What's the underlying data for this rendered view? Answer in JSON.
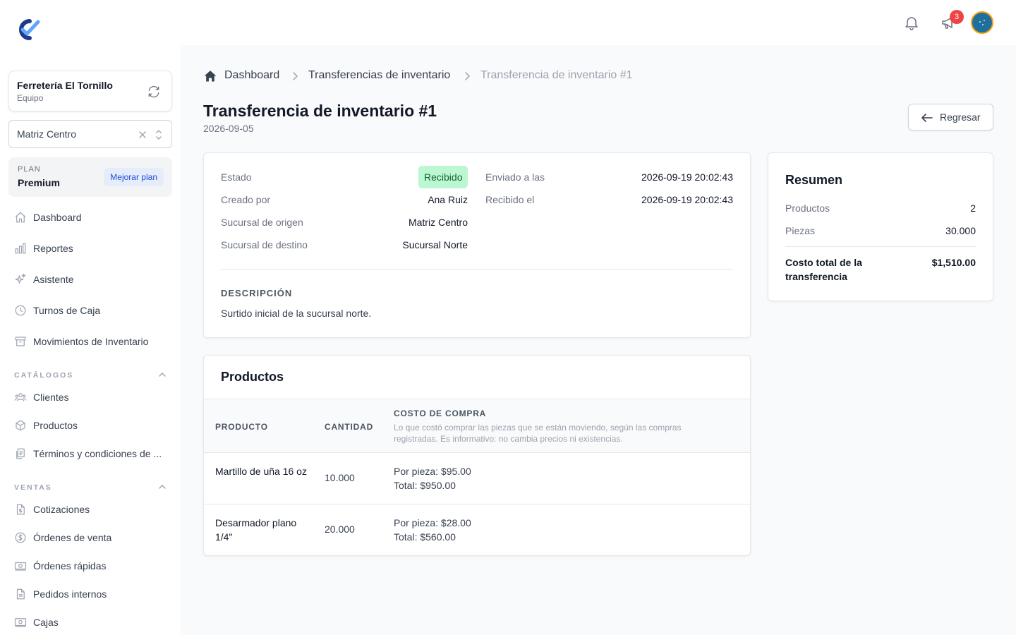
{
  "sidebar": {
    "company": {
      "name": "Ferretería El Tornillo",
      "sub": "Equipo"
    },
    "branch": "Matriz Centro",
    "plan": {
      "label": "PLAN",
      "name": "Premium",
      "upgrade": "Mejorar plan"
    },
    "main_items": [
      {
        "label": "Dashboard",
        "icon": "home-icon"
      },
      {
        "label": "Reportes",
        "icon": "chart-bar-icon"
      },
      {
        "label": "Asistente",
        "icon": "sparkles-icon"
      },
      {
        "label": "Turnos de Caja",
        "icon": "clock-icon"
      },
      {
        "label": "Movimientos de Inventario",
        "icon": "archive-icon"
      }
    ],
    "catalogos": {
      "title": "CATÁLOGOS",
      "items": [
        {
          "label": "Clientes",
          "icon": "users-icon"
        },
        {
          "label": "Productos",
          "icon": "cube-icon"
        },
        {
          "label": "Términos y condiciones de ...",
          "icon": "document-duplicate-icon"
        }
      ]
    },
    "ventas": {
      "title": "VENTAS",
      "items": [
        {
          "label": "Cotizaciones",
          "icon": "document-dollar-icon"
        },
        {
          "label": "Órdenes de venta",
          "icon": "currency-circle-icon"
        },
        {
          "label": "Órdenes rápidas",
          "icon": "banknotes-icon"
        },
        {
          "label": "Pedidos internos",
          "icon": "document-icon"
        },
        {
          "label": "Cajas",
          "icon": "cash-register-icon"
        }
      ]
    }
  },
  "header": {
    "notifications_badge": "3"
  },
  "breadcrumb": {
    "home": "Dashboard",
    "section": "Transferencias de inventario",
    "current": "Transferencia de inventario #1"
  },
  "page": {
    "title": "Transferencia de inventario #1",
    "date": "2026-09-05",
    "back": "Regresar"
  },
  "details": {
    "estado_label": "Estado",
    "estado_value": "Recibido",
    "creado_label": "Creado por",
    "creado_value": "Ana Ruiz",
    "origen_label": "Sucursal de origen",
    "origen_value": "Matriz Centro",
    "destino_label": "Sucursal de destino",
    "destino_value": "Sucursal Norte",
    "enviado_label": "Enviado a las",
    "enviado_value": "2026-09-19 20:02:43",
    "recibido_label": "Recibido el",
    "recibido_value": "2026-09-19 20:02:43",
    "descripcion_title": "DESCRIPCIÓN",
    "descripcion_text": "Surtido inicial de la sucursal norte."
  },
  "summary": {
    "title": "Resumen",
    "productos_label": "Productos",
    "productos_value": "2",
    "piezas_label": "Piezas",
    "piezas_value": "30.000",
    "total_label_1": "Costo total de la",
    "total_label_2": "transferencia",
    "total_value": "$1,510.00"
  },
  "products": {
    "title": "Productos",
    "columns": {
      "producto": "PRODUCTO",
      "cantidad": "CANTIDAD",
      "costo": "COSTO DE COMPRA",
      "costo_help": "Lo que costó comprar las piezas que se están moviendo, según las compras registradas. Es informativo: no cambia precios ni existencias."
    },
    "rows": [
      {
        "name": "Martillo de uña 16 oz",
        "qty": "10.000",
        "per_piece": "Por pieza: $95.00",
        "total": "Total: $950.00"
      },
      {
        "name": "Desarmador plano 1/4\"",
        "qty": "20.000",
        "per_piece": "Por pieza: $28.00",
        "total": "Total: $560.00"
      }
    ]
  },
  "colors": {
    "status_bg": "#bbf7d0",
    "status_text": "#166534",
    "badge": "#ef4444",
    "accent": "#1d4ed8",
    "logo_dark": "#1e3a8a",
    "logo_light": "#60a5fa"
  }
}
